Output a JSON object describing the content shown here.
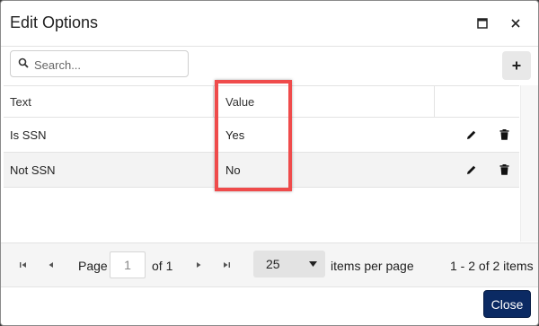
{
  "dialog": {
    "title": "Edit Options"
  },
  "toolbar": {
    "search_placeholder": "Search..."
  },
  "grid": {
    "columns": [
      "Text",
      "Value"
    ],
    "rows": [
      {
        "text": "Is SSN",
        "value": "Yes"
      },
      {
        "text": "Not SSN",
        "value": "No"
      }
    ]
  },
  "pager": {
    "page_label": "Page",
    "page_value": "1",
    "of_label": "of 1",
    "page_size": "25",
    "items_per_page_label": "items per page",
    "info": "1 - 2 of 2 items"
  },
  "footer": {
    "close_label": "Close"
  },
  "colors": {
    "primary": "#0b2a63",
    "highlight": "#ef4b4b",
    "alt_row": "#f3f3f3"
  },
  "icons": [
    "maximize-icon",
    "close-icon",
    "search-icon",
    "plus-icon",
    "pencil-icon",
    "trash-icon",
    "first-page-icon",
    "prev-page-icon",
    "next-page-icon",
    "last-page-icon",
    "caret-down-icon"
  ]
}
